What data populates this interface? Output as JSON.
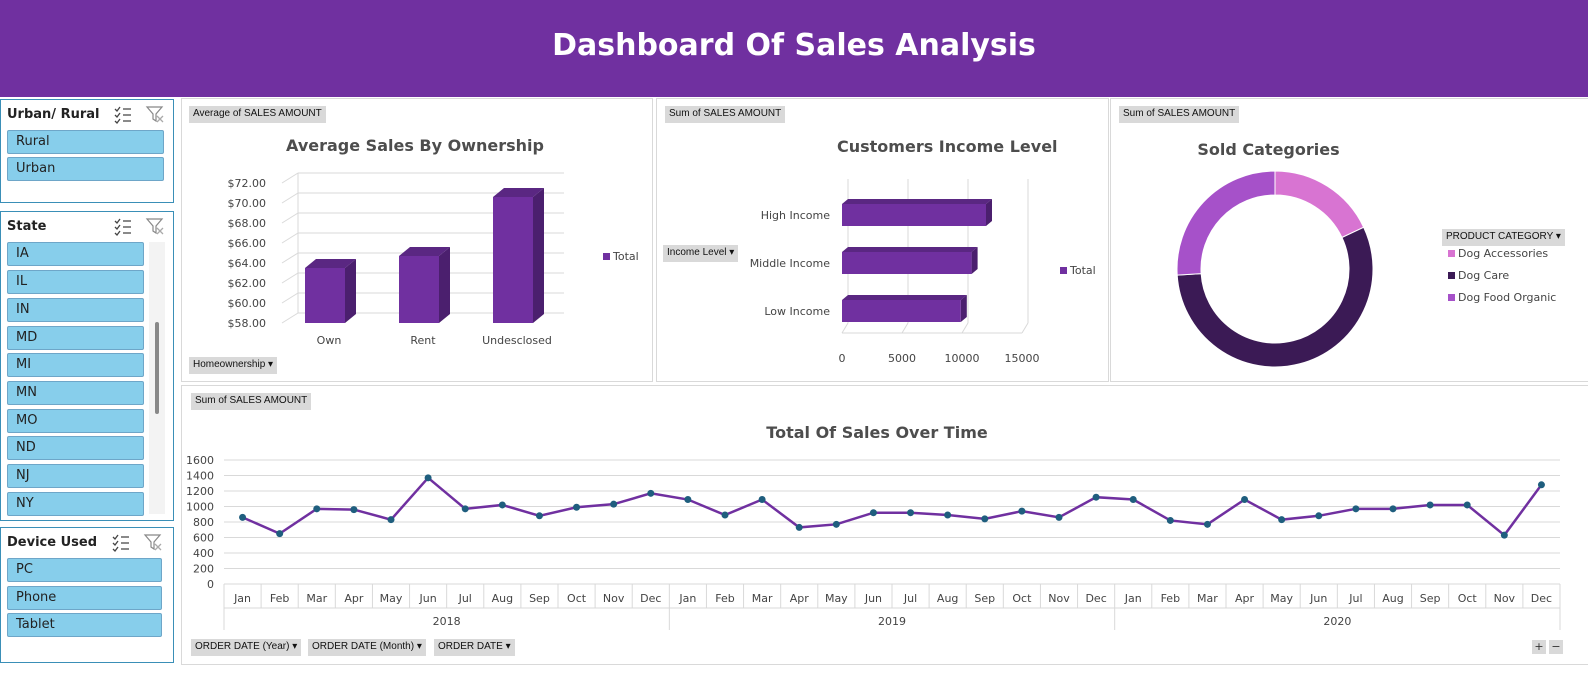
{
  "header": {
    "title": "Dashboard Of Sales Analysis"
  },
  "colors": {
    "banner": "#7030a0",
    "bar_front": "#7030a0",
    "bar_side": "#4b1f6e",
    "bar_top": "#5a2782",
    "slicer_button": "#87ceeb",
    "line": "#7030a0",
    "marker": "#1f5e7e",
    "donut": [
      "#d874d2",
      "#3b1a55",
      "#a651c9"
    ]
  },
  "slicers": {
    "urban_rural": {
      "title": "Urban/ Rural",
      "items": [
        "Rural",
        "Urban"
      ]
    },
    "state": {
      "title": "State",
      "items": [
        "IA",
        "IL",
        "IN",
        "MD",
        "MI",
        "MN",
        "MO",
        "ND",
        "NJ",
        "NY"
      ]
    },
    "device": {
      "title": "Device Used",
      "items": [
        "PC",
        "Phone",
        "Tablet"
      ]
    },
    "icons": [
      "multi-select-icon",
      "clear-filter-icon"
    ]
  },
  "panels": {
    "ownership": {
      "value_field": "Average of SALES AMOUNT",
      "axis_field": "Homeownership"
    },
    "income": {
      "value_field": "Sum of SALES AMOUNT",
      "axis_field": "Income Level"
    },
    "categories": {
      "value_field": "Sum of SALES AMOUNT",
      "legend_field": "PRODUCT CATEGORY"
    },
    "timeline": {
      "value_field": "Sum of SALES AMOUNT",
      "axis_fields": [
        "ORDER DATE (Year)",
        "ORDER DATE (Month)",
        "ORDER DATE"
      ],
      "expand": "+",
      "collapse": "−"
    }
  },
  "chart_data": [
    {
      "type": "bar",
      "title": "Average Sales By Ownership",
      "categories": [
        "Own",
        "Rent",
        "Undesclosed"
      ],
      "series": [
        {
          "name": "Total",
          "values": [
            63.5,
            64.7,
            70.6
          ]
        }
      ],
      "ylim": [
        58,
        72
      ],
      "yticks": [
        "$58.00",
        "$60.00",
        "$62.00",
        "$64.00",
        "$66.00",
        "$68.00",
        "$70.00",
        "$72.00"
      ],
      "ytick_values": [
        58,
        60,
        62,
        64,
        66,
        68,
        70,
        72
      ],
      "legend": "right",
      "grid": true
    },
    {
      "type": "bar",
      "orientation": "horizontal",
      "title": "Customers Income Level",
      "categories": [
        "High Income",
        "Middle Income",
        "Low Income"
      ],
      "series": [
        {
          "name": "Total",
          "values": [
            12000,
            10800,
            9900
          ]
        }
      ],
      "xlim": [
        0,
        15000
      ],
      "xticks": [
        "0",
        "5000",
        "10000",
        "15000"
      ],
      "xtick_values": [
        0,
        5000,
        10000,
        15000
      ],
      "legend": "right",
      "grid": true
    },
    {
      "type": "pie",
      "subtype": "donut",
      "title": "Sold Categories",
      "categories": [
        "Dog Accessories",
        "Dog Care",
        "Dog Food Organic"
      ],
      "values": [
        18,
        56,
        26
      ],
      "legend": "right"
    },
    {
      "type": "line",
      "title": "Total Of Sales Over Time",
      "years": [
        "2018",
        "2019",
        "2020"
      ],
      "months": [
        "Jan",
        "Feb",
        "Mar",
        "Apr",
        "May",
        "Jun",
        "Jul",
        "Aug",
        "Sep",
        "Oct",
        "Nov",
        "Dec"
      ],
      "series": [
        {
          "values": [
            860,
            650,
            970,
            960,
            830,
            1370,
            970,
            1020,
            880,
            990,
            1030,
            1170,
            1090,
            890,
            1090,
            730,
            770,
            920,
            920,
            890,
            840,
            940,
            860,
            1120,
            1090,
            820,
            770,
            1090,
            830,
            880,
            970,
            970,
            1020,
            1020,
            630,
            1280
          ]
        }
      ],
      "ylim": [
        0,
        1600
      ],
      "yticks": [
        "0",
        "200",
        "400",
        "600",
        "800",
        "1000",
        "1200",
        "1400",
        "1600"
      ],
      "ytick_values": [
        0,
        200,
        400,
        600,
        800,
        1000,
        1200,
        1400,
        1600
      ],
      "grid": true
    }
  ]
}
